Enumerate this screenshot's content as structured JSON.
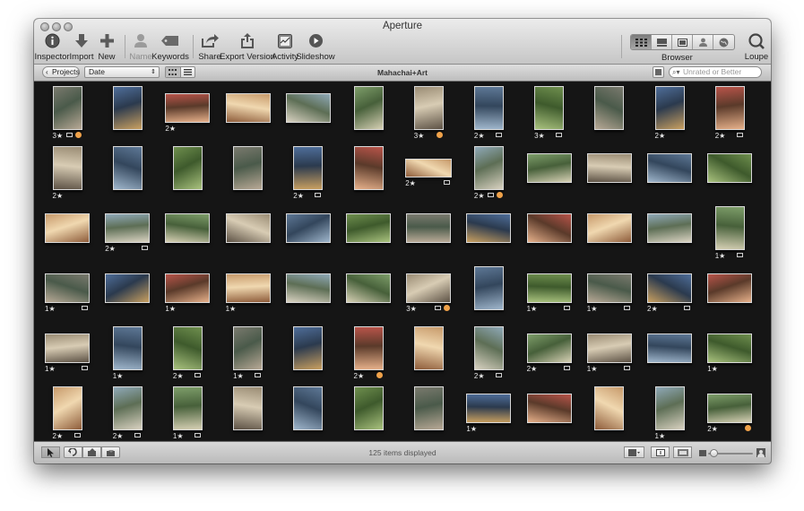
{
  "window": {
    "title": "Aperture"
  },
  "toolbar": {
    "inspector": "Inspector",
    "import": "Import",
    "new": "New",
    "name": "Name",
    "keywords": "Keywords",
    "share": "Share",
    "export_version": "Export Version",
    "activity": "Activity",
    "slideshow": "Slideshow",
    "browser": "Browser",
    "loupe": "Loupe"
  },
  "pathbar": {
    "projects": "Projects",
    "sort": "Date",
    "title": "Mahachai+Art",
    "filter_placeholder": "Unrated or Better"
  },
  "status": {
    "text": "125 items displayed"
  },
  "icons": {
    "inspector": "info-icon",
    "import": "import-arrow-icon",
    "new": "plus-icon",
    "name": "person-icon",
    "keywords": "tag-icon",
    "share": "share-icon",
    "export": "export-icon",
    "activity": "activity-icon",
    "slideshow": "play-icon",
    "loupe": "loupe-icon"
  },
  "colors": {
    "grid_bg": "#151515",
    "label_orange": "#f0a24a",
    "toolbar_bg": "#d4d4d4"
  },
  "thumbnails": [
    {
      "rating": "3★",
      "badge": true,
      "color": true
    },
    {
      "rating": "",
      "badge": false,
      "color": false
    },
    {
      "rating": "2★",
      "badge": false,
      "color": false
    },
    {
      "rating": "",
      "badge": false,
      "color": false
    },
    {
      "rating": "",
      "badge": false,
      "color": false
    },
    {
      "rating": "",
      "badge": false,
      "color": false
    },
    {
      "rating": "3★",
      "badge": false,
      "color": true
    },
    {
      "rating": "2★",
      "badge": true,
      "color": false
    },
    {
      "rating": "3★",
      "badge": true,
      "color": false
    },
    {
      "rating": "",
      "badge": false,
      "color": false
    },
    {
      "rating": "2★",
      "badge": false,
      "color": false
    },
    {
      "rating": "2★",
      "badge": true,
      "color": false
    },
    {
      "rating": "2★",
      "badge": false,
      "color": false
    },
    {
      "rating": "",
      "badge": false,
      "color": false
    },
    {
      "rating": "",
      "badge": false,
      "color": false
    },
    {
      "rating": "",
      "badge": false,
      "color": false
    },
    {
      "rating": "2★",
      "badge": true,
      "color": false
    },
    {
      "rating": "",
      "badge": false,
      "color": false
    },
    {
      "rating": "2★",
      "badge": true,
      "color": false
    },
    {
      "rating": "2★",
      "badge": true,
      "color": true
    },
    {
      "rating": "",
      "badge": false,
      "color": false
    },
    {
      "rating": "",
      "badge": false,
      "color": false
    },
    {
      "rating": "",
      "badge": false,
      "color": false
    },
    {
      "rating": "",
      "badge": false,
      "color": false
    },
    {
      "rating": "",
      "badge": false,
      "color": false
    },
    {
      "rating": "2★",
      "badge": true,
      "color": false
    },
    {
      "rating": "",
      "badge": false,
      "color": false
    },
    {
      "rating": "",
      "badge": false,
      "color": false
    },
    {
      "rating": "",
      "badge": false,
      "color": false
    },
    {
      "rating": "",
      "badge": false,
      "color": false
    },
    {
      "rating": "",
      "badge": false,
      "color": false
    },
    {
      "rating": "",
      "badge": false,
      "color": false
    },
    {
      "rating": "",
      "badge": false,
      "color": false
    },
    {
      "rating": "",
      "badge": false,
      "color": false
    },
    {
      "rating": "",
      "badge": false,
      "color": false
    },
    {
      "rating": "1★",
      "badge": true,
      "color": false
    },
    {
      "rating": "1★",
      "badge": true,
      "color": false
    },
    {
      "rating": "",
      "badge": false,
      "color": false
    },
    {
      "rating": "1★",
      "badge": false,
      "color": false
    },
    {
      "rating": "1★",
      "badge": false,
      "color": false
    },
    {
      "rating": "",
      "badge": false,
      "color": false
    },
    {
      "rating": "",
      "badge": false,
      "color": false
    },
    {
      "rating": "3★",
      "badge": true,
      "color": true
    },
    {
      "rating": "",
      "badge": false,
      "color": false
    },
    {
      "rating": "1★",
      "badge": true,
      "color": false
    },
    {
      "rating": "1★",
      "badge": true,
      "color": false
    },
    {
      "rating": "2★",
      "badge": true,
      "color": false
    },
    {
      "rating": "",
      "badge": false,
      "color": false
    },
    {
      "rating": "1★",
      "badge": true,
      "color": false
    },
    {
      "rating": "1★",
      "badge": false,
      "color": false
    },
    {
      "rating": "2★",
      "badge": true,
      "color": false
    },
    {
      "rating": "1★",
      "badge": true,
      "color": false
    },
    {
      "rating": "",
      "badge": false,
      "color": false
    },
    {
      "rating": "2★",
      "badge": false,
      "color": true
    },
    {
      "rating": "",
      "badge": false,
      "color": false
    },
    {
      "rating": "2★",
      "badge": true,
      "color": false
    },
    {
      "rating": "2★",
      "badge": true,
      "color": false
    },
    {
      "rating": "1★",
      "badge": true,
      "color": false
    },
    {
      "rating": "",
      "badge": false,
      "color": false
    },
    {
      "rating": "1★",
      "badge": false,
      "color": false
    },
    {
      "rating": "2★",
      "badge": true,
      "color": false
    },
    {
      "rating": "2★",
      "badge": true,
      "color": false
    },
    {
      "rating": "1★",
      "badge": true,
      "color": false
    },
    {
      "rating": "",
      "badge": false,
      "color": false
    },
    {
      "rating": "",
      "badge": false,
      "color": false
    },
    {
      "rating": "",
      "badge": false,
      "color": false
    },
    {
      "rating": "",
      "badge": false,
      "color": false
    },
    {
      "rating": "1★",
      "badge": false,
      "color": false
    },
    {
      "rating": "",
      "badge": false,
      "color": false
    },
    {
      "rating": "",
      "badge": false,
      "color": false
    },
    {
      "rating": "1★",
      "badge": false,
      "color": false
    },
    {
      "rating": "2★",
      "badge": false,
      "color": true
    }
  ]
}
